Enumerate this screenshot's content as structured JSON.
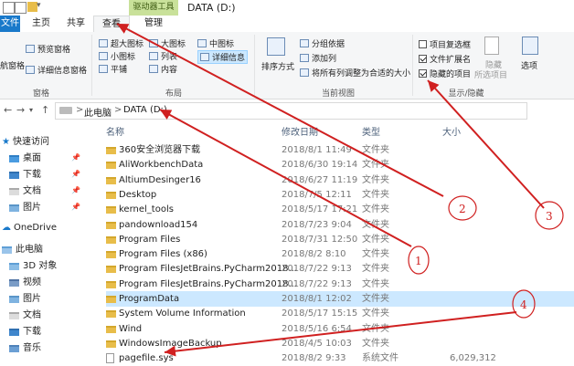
{
  "colors": {
    "accent": "#1979ca",
    "annotation": "#d02020",
    "drive_tools_tab": "#93c13b",
    "selected_row": "#cce8ff"
  },
  "titlebar": {
    "title": "DATA (D:)",
    "drive_tools": "驱动器工具"
  },
  "tabs": {
    "file": "文件",
    "home": "主页",
    "share": "共享",
    "view": "查看",
    "manage": "管理"
  },
  "ribbon": {
    "pane": {
      "nav_pane": "航窗格",
      "preview": "预览窗格",
      "details": "详细信息窗格",
      "group": "窗格"
    },
    "layout": {
      "xl_icons": "超大图标",
      "l_icons": "大图标",
      "m_icons": "中图标",
      "s_icons": "小图标",
      "list": "列表",
      "tiles": "平铺",
      "content": "内容",
      "details": "详细信息",
      "group": "布局"
    },
    "current_view": {
      "sort": "排序方式",
      "group_by": "分组依据",
      "add_col": "添加列",
      "fit_cols": "将所有列调整为合适的大小",
      "group": "当前视图"
    },
    "show_hide": {
      "item_checkbox": "项目复选框",
      "file_ext": "文件扩展名",
      "hidden_items": "隐藏的项目",
      "hide": "隐藏",
      "hide_sub": "所选项目",
      "options": "选项",
      "group": "显示/隐藏"
    }
  },
  "address": {
    "this_pc": "此电脑",
    "drive": "DATA (D:)",
    "sep": ">"
  },
  "nav": {
    "quick_access": "快速访问",
    "desktop": "桌面",
    "downloads": "下载",
    "documents": "文档",
    "pictures": "图片",
    "onedrive": "OneDrive",
    "this_pc": "此电脑",
    "objects3d": "3D 对象",
    "videos": "视频",
    "pics2": "图片",
    "docs2": "文档",
    "dl2": "下载",
    "music": "音乐"
  },
  "columns": {
    "name": "名称",
    "date": "修改日期",
    "type": "类型",
    "size": "大小"
  },
  "files": [
    {
      "name": "360安全浏览器下载",
      "date": "2018/8/1 11:49",
      "type": "文件夹",
      "size": ""
    },
    {
      "name": "AliWorkbenchData",
      "date": "2018/6/30 19:14",
      "type": "文件夹",
      "size": ""
    },
    {
      "name": "AltiumDesinger16",
      "date": "2018/6/27 11:19",
      "type": "文件夹",
      "size": ""
    },
    {
      "name": "Desktop",
      "date": "2018/7/5 12:11",
      "type": "文件夹",
      "size": ""
    },
    {
      "name": "kernel_tools",
      "date": "2018/5/17 17:21",
      "type": "文件夹",
      "size": ""
    },
    {
      "name": "pandownload154",
      "date": "2018/7/23 9:04",
      "type": "文件夹",
      "size": ""
    },
    {
      "name": "Program Files",
      "date": "2018/7/31 12:50",
      "type": "文件夹",
      "size": ""
    },
    {
      "name": "Program Files (x86)",
      "date": "2018/8/2 8:10",
      "type": "文件夹",
      "size": ""
    },
    {
      "name": "Program FilesJetBrains.PyCharm2018...",
      "date": "2018/7/22 9:13",
      "type": "文件夹",
      "size": ""
    },
    {
      "name": "Program FilesJetBrains.PyCharm2018...",
      "date": "2018/7/22 9:13",
      "type": "文件夹",
      "size": ""
    },
    {
      "name": "ProgramData",
      "date": "2018/8/1 12:02",
      "type": "文件夹",
      "size": ""
    },
    {
      "name": "System Volume Information",
      "date": "2018/5/17 15:15",
      "type": "文件夹",
      "size": ""
    },
    {
      "name": "Wind",
      "date": "2018/5/16 6:54",
      "type": "文件夹",
      "size": ""
    },
    {
      "name": "WindowsImageBackup",
      "date": "2018/4/5 10:03",
      "type": "文件夹",
      "size": ""
    },
    {
      "name": "pagefile.sys",
      "date": "2018/8/2 9:33",
      "type": "系统文件",
      "size": "6,029,312"
    }
  ],
  "annotations": {
    "c1": "1",
    "c2": "2",
    "c3": "3",
    "c4": "4"
  }
}
